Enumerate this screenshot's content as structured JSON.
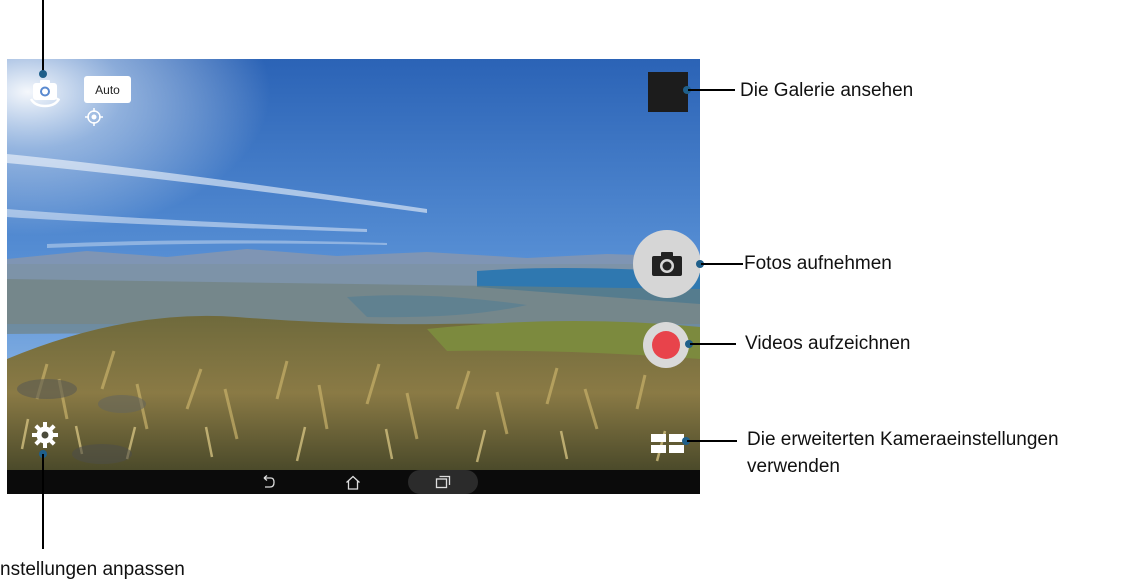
{
  "camera": {
    "mode_badge": "Auto",
    "accent_color": "#1f5f8a",
    "record_color": "#e8434b"
  },
  "icons": {
    "switch_camera": "camera-switch-icon",
    "focus": "focus-target-icon",
    "settings": "gear-icon",
    "capture": "camera-icon",
    "record": "record-dot-icon",
    "modes": "grid-modes-icon",
    "nav_back": "back-icon",
    "nav_home": "home-icon",
    "nav_recents": "recents-icon"
  },
  "callouts": {
    "gallery": "Die Galerie ansehen",
    "photo": "Fotos aufnehmen",
    "video": "Videos aufzeichnen",
    "advanced_line1": "Die erweiterten Kameraeinstellungen",
    "advanced_line2": "verwenden",
    "settings": "nstellungen anpassen"
  }
}
